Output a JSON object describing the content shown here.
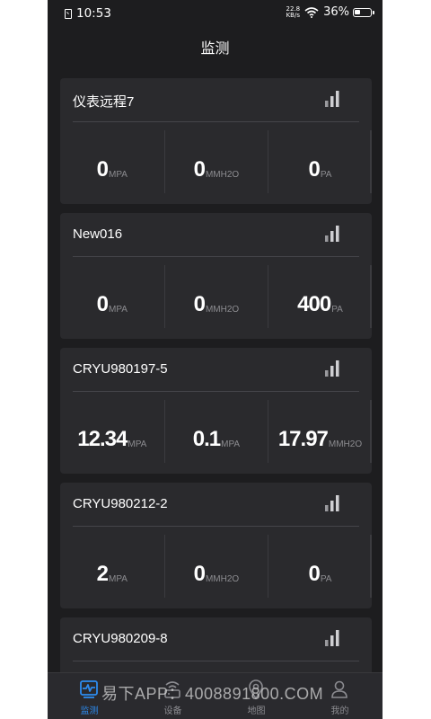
{
  "status_bar": {
    "time": "10:53",
    "net_speed_value": "22.8",
    "net_speed_unit": "KB/s",
    "battery": "36%",
    "battery_level": 0.36
  },
  "header": {
    "title": "监测"
  },
  "cards": [
    {
      "title": "仪表远程7",
      "metrics": [
        {
          "value": "0",
          "unit": "MPA"
        },
        {
          "value": "0",
          "unit": "MMH2O"
        },
        {
          "value": "0",
          "unit": "PA"
        }
      ]
    },
    {
      "title": "New016",
      "metrics": [
        {
          "value": "0",
          "unit": "MPA"
        },
        {
          "value": "0",
          "unit": "MMH2O"
        },
        {
          "value": "400",
          "unit": "PA"
        }
      ]
    },
    {
      "title": "CRYU980197-5",
      "metrics": [
        {
          "value": "12.34",
          "unit": "MPA"
        },
        {
          "value": "0.1",
          "unit": "MPA"
        },
        {
          "value": "17.97",
          "unit": "MMH2O"
        }
      ]
    },
    {
      "title": "CRYU980212-2",
      "metrics": [
        {
          "value": "2",
          "unit": "MPA"
        },
        {
          "value": "0",
          "unit": "MMH2O"
        },
        {
          "value": "0",
          "unit": "PA"
        }
      ]
    },
    {
      "title": "CRYU980209-8",
      "metrics": []
    }
  ],
  "tabs": [
    {
      "label": "监测",
      "icon": "monitor-icon",
      "active": true
    },
    {
      "label": "设备",
      "icon": "device-icon",
      "active": false
    },
    {
      "label": "地图",
      "icon": "map-pin-icon",
      "active": false
    },
    {
      "label": "我的",
      "icon": "user-icon",
      "active": false
    }
  ],
  "watermark": "易下APP：4008891800.COM",
  "colors": {
    "accent": "#2d8cf0",
    "background": "#1d1d1f",
    "card": "#2a2a2d"
  }
}
